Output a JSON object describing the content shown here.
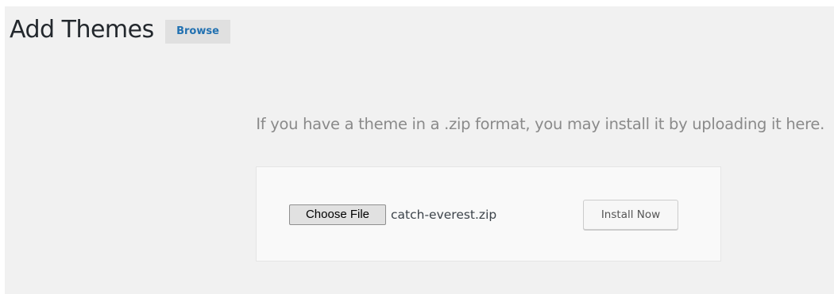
{
  "header": {
    "title": "Add Themes",
    "browse_label": "Browse"
  },
  "upload": {
    "help_text": "If you have a theme in a .zip format, you may install it by uploading it here.",
    "choose_file_label": "Choose File",
    "selected_file": "catch-everest.zip",
    "install_label": "Install Now"
  },
  "colors": {
    "page_background": "#f1f1f1",
    "link_blue": "#2271b1",
    "help_text_gray": "#8a8a8a",
    "card_background": "#f9f9f9"
  }
}
